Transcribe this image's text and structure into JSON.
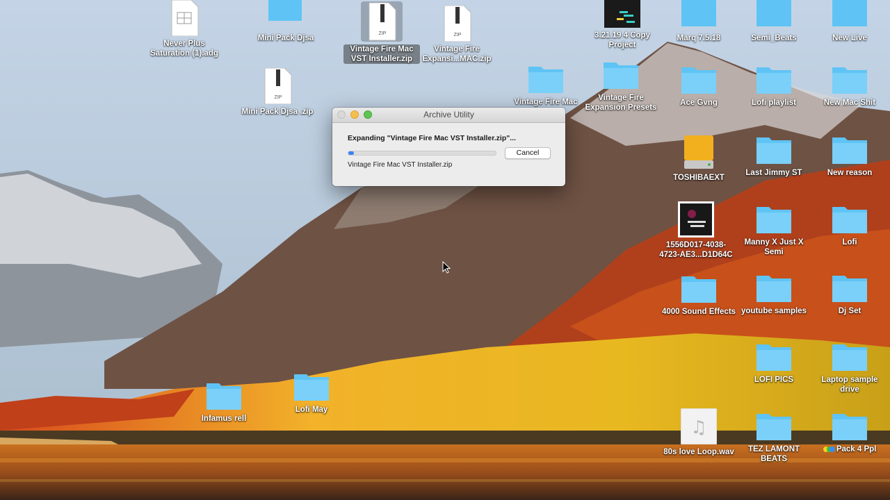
{
  "desktop": {
    "icons": [
      {
        "id": "never-plus",
        "label": "Never Plus Saturation (1).adg",
        "type": "adg-file"
      },
      {
        "id": "mini-pack-folder",
        "label": "Mini Pack Djsa",
        "type": "folder"
      },
      {
        "id": "vintage-vst-zip",
        "label": "Vintage Fire Mac VST Installer.zip",
        "type": "zip-file",
        "selected": true
      },
      {
        "id": "vintage-exp-zip",
        "label": "Vintage Fire Expansi...MAC.zip",
        "type": "zip-file"
      },
      {
        "id": "mini-pack-zip",
        "label": "Mini Pack Djsa .zip",
        "type": "zip-file"
      },
      {
        "id": "vintage-mac-folder",
        "label": "Vintage Fire Mac",
        "type": "folder"
      },
      {
        "id": "vintage-presets",
        "label": "Vintage Fire Expansion Presets",
        "type": "folder"
      },
      {
        "id": "copy-project",
        "label": "3.21.19 4 Copy Project",
        "type": "project"
      },
      {
        "id": "marq",
        "label": "Marq 7.5.18",
        "type": "folder"
      },
      {
        "id": "semi-beats",
        "label": "Semi_Beats",
        "type": "folder"
      },
      {
        "id": "new-live",
        "label": "New Live",
        "type": "folder"
      },
      {
        "id": "ace-gvng",
        "label": "Ace Gvng",
        "type": "folder"
      },
      {
        "id": "lofi-playlist",
        "label": "Lofi playlist",
        "type": "folder"
      },
      {
        "id": "new-mac-shit",
        "label": "New Mac Shit",
        "type": "folder"
      },
      {
        "id": "toshibaext",
        "label": "TOSHIBAEXT",
        "type": "drive"
      },
      {
        "id": "last-jimmy",
        "label": "Last Jimmy ST",
        "type": "folder"
      },
      {
        "id": "new-reason",
        "label": "New reason",
        "type": "folder"
      },
      {
        "id": "image-file",
        "label": "1556D017-4038-4723-AE3...D1D64C",
        "type": "image"
      },
      {
        "id": "manny",
        "label": "Manny X Just X Semi",
        "type": "folder"
      },
      {
        "id": "lofi",
        "label": "Lofi",
        "type": "folder"
      },
      {
        "id": "sound-effects",
        "label": "4000 Sound Effects",
        "type": "folder"
      },
      {
        "id": "youtube",
        "label": "youtube samples",
        "type": "folder"
      },
      {
        "id": "dj-set",
        "label": "Dj Set",
        "type": "folder"
      },
      {
        "id": "lofi-pics",
        "label": "LOFI PICS",
        "type": "folder"
      },
      {
        "id": "laptop-drive",
        "label": "Laptop sample drive",
        "type": "folder"
      },
      {
        "id": "infamus",
        "label": "Infamus rell",
        "type": "folder"
      },
      {
        "id": "lofi-may",
        "label": "Lofi  May",
        "type": "folder"
      },
      {
        "id": "80s-love",
        "label": "80s love  Loop.wav",
        "type": "audio"
      },
      {
        "id": "tez-lamont",
        "label": "TEZ LAMONT BEATS",
        "type": "folder"
      },
      {
        "id": "pack-4",
        "label": "Pack 4 Ppl",
        "type": "tagged-folder"
      }
    ]
  },
  "dialog": {
    "title": "Archive Utility",
    "status": "Expanding \"Vintage Fire Mac VST Installer.zip\"...",
    "progress_fraction": 0.04,
    "cancel_label": "Cancel",
    "filename": "Vintage Fire Mac VST Installer.zip"
  },
  "colors": {
    "folder_blue": "#5fc4f5",
    "accent": "#3a82f6",
    "drive_gold": "#f2b01e"
  }
}
